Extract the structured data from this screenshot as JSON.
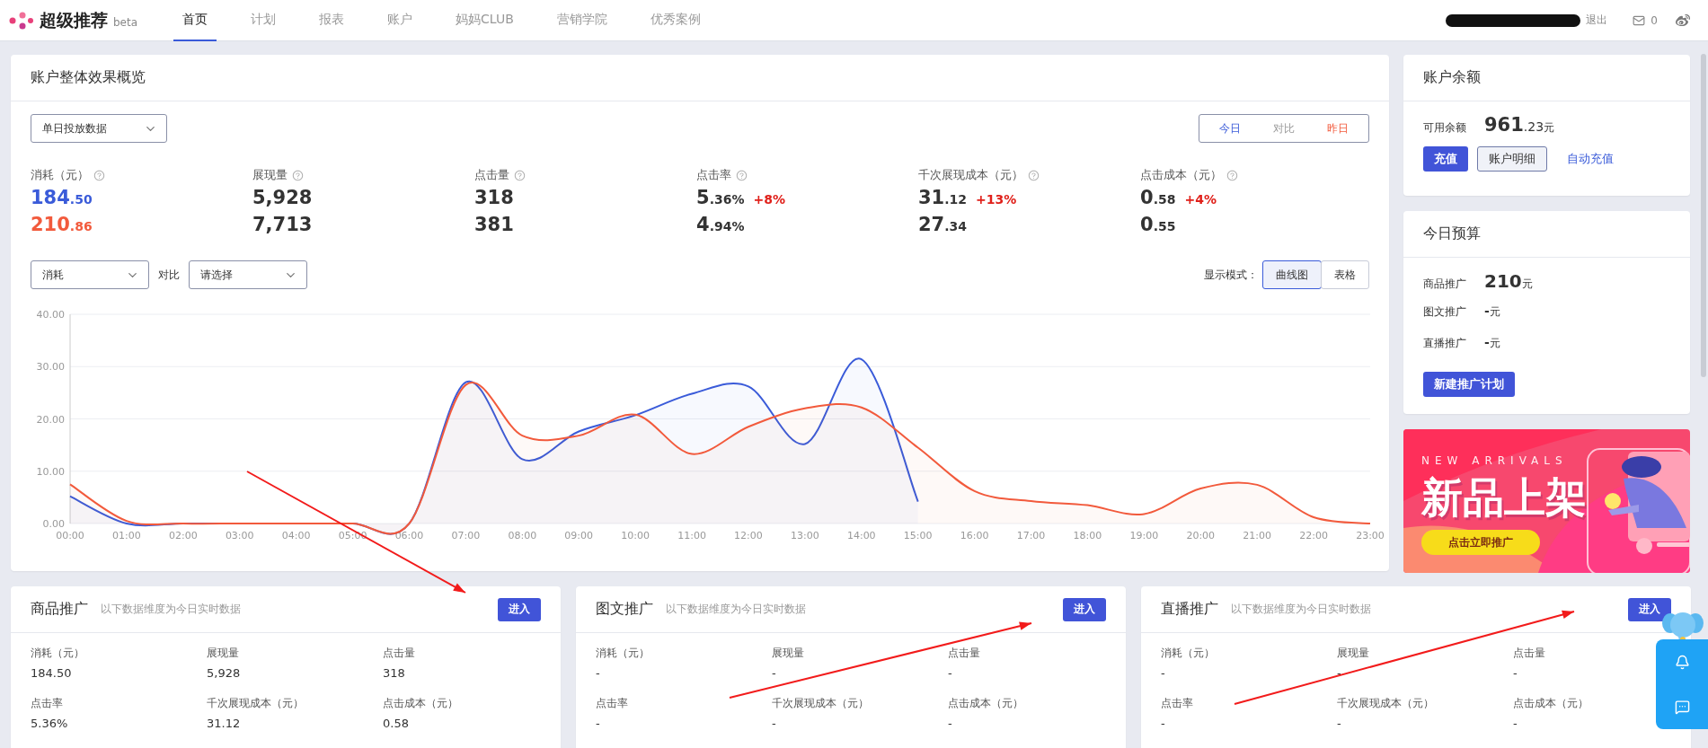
{
  "header": {
    "brand": "超级推荐",
    "badge": "beta",
    "nav": [
      {
        "label": "首页",
        "selected": true
      },
      {
        "label": "计划",
        "selected": false
      },
      {
        "label": "报表",
        "selected": false
      },
      {
        "label": "账户",
        "selected": false
      },
      {
        "label": "妈妈CLUB",
        "selected": false
      },
      {
        "label": "营销学院",
        "selected": false
      },
      {
        "label": "优秀案例",
        "selected": false
      }
    ],
    "logout": "退出",
    "mail_count": "0"
  },
  "overview": {
    "title": "账户整体效果概览",
    "range_select": "单日投放数据",
    "legend": [
      {
        "label": "今日",
        "color": "#3a5bd9"
      },
      {
        "label": "对比",
        "color": "#999999"
      },
      {
        "label": "昨日",
        "color": "#f25a3c"
      }
    ],
    "metrics": [
      {
        "label": "消耗（元）",
        "highlight": true,
        "rows": [
          {
            "main": "184",
            "fraction": ".50"
          },
          {
            "main": "210",
            "fraction": ".86"
          }
        ]
      },
      {
        "label": "展现量",
        "highlight": false,
        "rows": [
          {
            "main": "5,928"
          },
          {
            "main": "7,713"
          }
        ]
      },
      {
        "label": "点击量",
        "highlight": false,
        "rows": [
          {
            "main": "318"
          },
          {
            "main": "381"
          }
        ]
      },
      {
        "label": "点击率",
        "highlight": false,
        "rows": [
          {
            "main": "5",
            "fraction": ".36%",
            "change": "+8%"
          },
          {
            "main": "4",
            "fraction": ".94%"
          }
        ]
      },
      {
        "label": "千次展现成本（元）",
        "highlight": false,
        "rows": [
          {
            "main": "31",
            "fraction": ".12",
            "change": "+13%"
          },
          {
            "main": "27",
            "fraction": ".34"
          }
        ]
      },
      {
        "label": "点击成本（元）",
        "highlight": false,
        "rows": [
          {
            "main": "0",
            "fraction": ".58",
            "change": "+4%"
          },
          {
            "main": "0",
            "fraction": ".55"
          }
        ]
      }
    ],
    "metric_select": "消耗",
    "compare_label": "对比",
    "compare_select": {
      "placeholder": "请选择"
    },
    "mode_label": "显示模式：",
    "modes": [
      {
        "label": "曲线图",
        "selected": true
      },
      {
        "label": "表格",
        "selected": false
      }
    ],
    "chart_data": {
      "type": "area",
      "grid": true,
      "categories": [
        "00:00",
        "01:00",
        "02:00",
        "03:00",
        "04:00",
        "05:00",
        "06:00",
        "07:00",
        "08:00",
        "09:00",
        "10:00",
        "11:00",
        "12:00",
        "13:00",
        "14:00",
        "15:00",
        "16:00",
        "17:00",
        "18:00",
        "19:00",
        "20:00",
        "21:00",
        "22:00",
        "23:00"
      ],
      "ylim": [
        0,
        40
      ],
      "yticks": [
        {
          "value": 0,
          "label": "0.00"
        },
        {
          "value": 10,
          "label": "10.00"
        },
        {
          "value": 20,
          "label": "20.00"
        },
        {
          "value": 30,
          "label": "30.00"
        },
        {
          "value": 40,
          "label": "40.00"
        }
      ],
      "series": [
        {
          "color": "#3a5bd9",
          "values": [
            5.2,
            0,
            0,
            0,
            0,
            0,
            0,
            27,
            12.3,
            17.6,
            20.7,
            24.8,
            26.2,
            15.2,
            31.4,
            4.2,
            null,
            null,
            null,
            null,
            null,
            null,
            null,
            null
          ]
        },
        {
          "color": "#f25a3c",
          "values": [
            7.5,
            0.5,
            0,
            0,
            0,
            0,
            0,
            26.5,
            16.8,
            16.8,
            20.8,
            13.3,
            18.5,
            22,
            22.2,
            14.5,
            6.2,
            4.3,
            3.5,
            1.8,
            6.7,
            7.4,
            1.2,
            0
          ]
        }
      ]
    }
  },
  "balance": {
    "title": "账户余额",
    "label": "可用余额",
    "main": "961",
    "fraction": ".23",
    "unit": "元",
    "buttons": [
      {
        "label": "充值",
        "kind": "primary"
      },
      {
        "label": "账户明细",
        "kind": "outline"
      },
      {
        "label": "自动充值",
        "kind": "link"
      }
    ]
  },
  "budget": {
    "title": "今日预算",
    "rows": [
      {
        "label": "商品推广",
        "value": "210",
        "unit": "元"
      },
      {
        "label": "图文推广",
        "value": "-",
        "unit": "元"
      },
      {
        "label": "直播推广",
        "value": "-",
        "unit": "元"
      }
    ],
    "button": "新建推广计划"
  },
  "banner": {
    "kicker": "NEW ARRIVALS",
    "title": "新品上架",
    "button": "点击立即推广"
  },
  "promos": [
    {
      "title": "商品推广",
      "subtitle": "以下数据维度为今日实时数据",
      "button": "进入",
      "metrics": [
        {
          "label": "消耗（元）",
          "value": "184.50"
        },
        {
          "label": "展现量",
          "value": "5,928"
        },
        {
          "label": "点击量",
          "value": "318"
        },
        {
          "label": "点击率",
          "value": "5.36%"
        },
        {
          "label": "千次展现成本（元）",
          "value": "31.12"
        },
        {
          "label": "点击成本（元）",
          "value": "0.58"
        }
      ]
    },
    {
      "title": "图文推广",
      "subtitle": "以下数据维度为今日实时数据",
      "button": "进入",
      "metrics": [
        {
          "label": "消耗（元）",
          "value": "-"
        },
        {
          "label": "展现量",
          "value": "-"
        },
        {
          "label": "点击量",
          "value": "-"
        },
        {
          "label": "点击率",
          "value": "-"
        },
        {
          "label": "千次展现成本（元）",
          "value": "-"
        },
        {
          "label": "点击成本（元）",
          "value": "-"
        }
      ]
    },
    {
      "title": "直播推广",
      "subtitle": "以下数据维度为今日实时数据",
      "button": "进入",
      "metrics": [
        {
          "label": "消耗（元）",
          "value": "-"
        },
        {
          "label": "展现量",
          "value": "-"
        },
        {
          "label": "点击量",
          "value": "-"
        },
        {
          "label": "点击率",
          "value": "-"
        },
        {
          "label": "千次展现成本（元）",
          "value": "-"
        },
        {
          "label": "点击成本（元）",
          "value": "-"
        }
      ]
    }
  ]
}
